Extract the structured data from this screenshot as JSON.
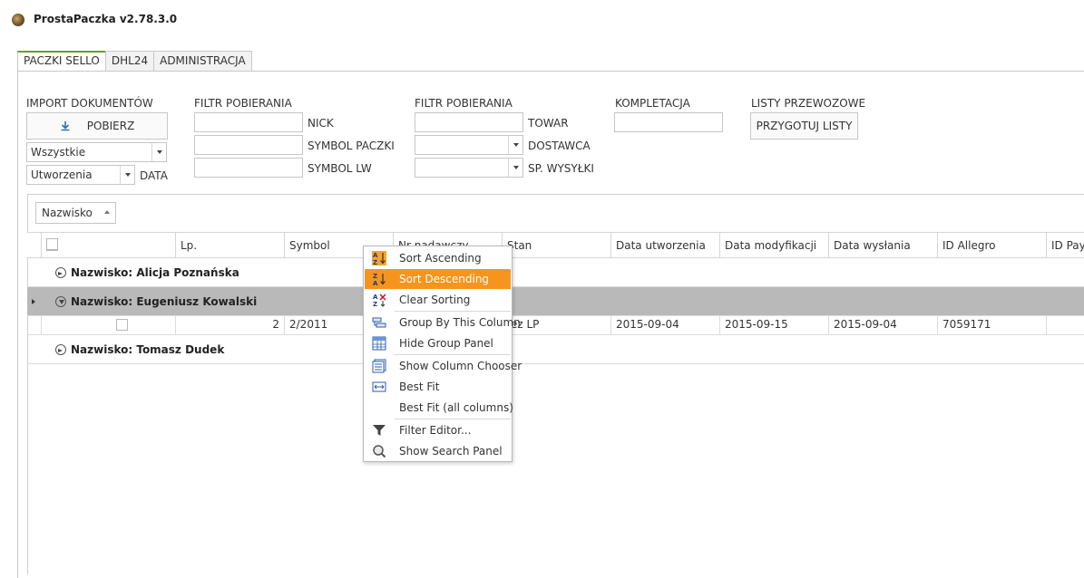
{
  "app": {
    "title": "ProstaPaczka v2.78.3.0"
  },
  "tabs": [
    {
      "label": "PACZKI SELLO",
      "active": true
    },
    {
      "label": "DHL24",
      "active": false
    },
    {
      "label": "ADMINISTRACJA",
      "active": false
    }
  ],
  "import": {
    "heading": "IMPORT DOKUMENTÓW",
    "button_label": "POBIERZ",
    "status_combo": "Wszystkie",
    "date_combo": "Utworzenia",
    "date_label": "DATA"
  },
  "filter1": {
    "heading": "FILTR POBIERANIA",
    "fields": [
      {
        "label": "NICK",
        "value": ""
      },
      {
        "label": "SYMBOL PACZKI",
        "value": ""
      },
      {
        "label": "SYMBOL LW",
        "value": ""
      }
    ]
  },
  "filter2": {
    "heading": "FILTR POBIERANIA",
    "towar_label": "TOWAR",
    "towar_value": "",
    "dostawca_label": "DOSTAWCA",
    "dostawca_value": "",
    "wysylka_label": "SP. WYSYŁKI",
    "wysylka_value": ""
  },
  "kompletacja": {
    "heading": "KOMPLETACJA",
    "value": ""
  },
  "listy": {
    "heading": "LISTY PRZEWOZOWE",
    "button_label": "PRZYGOTUJ LISTY"
  },
  "grid": {
    "group_chip": "Nazwisko",
    "columns": [
      "Lp.",
      "Symbol",
      "Nr nadawczy",
      "Stan",
      "Data utworzenia",
      "Data modyfikacji",
      "Data wysłania",
      "ID Allegro",
      "ID PayU"
    ],
    "groups": [
      {
        "label": "Nazwisko: Alicja Poznańska",
        "expanded": false,
        "selected": false
      },
      {
        "label": "Nazwisko: Eugeniusz Kowalski",
        "expanded": true,
        "selected": true
      },
      {
        "label": "Nazwisko: Tomasz Dudek",
        "expanded": false,
        "selected": false
      }
    ],
    "row": {
      "lp": "2",
      "symbol": "2/2011",
      "stan": "ez LP",
      "data_utworzenia": "2015-09-04",
      "data_modyfikacji": "2015-09-15",
      "data_wyslania": "2015-09-04",
      "id_allegro": "7059171"
    }
  },
  "context_menu": {
    "items": [
      {
        "label": "Sort Ascending",
        "icon": "sort-ascending-icon"
      },
      {
        "label": "Sort Descending",
        "icon": "sort-descending-icon",
        "highlighted": true
      },
      {
        "label": "Clear Sorting",
        "icon": "clear-sorting-icon"
      },
      {
        "label": "Group By This Column",
        "icon": "group-by-icon"
      },
      {
        "label": "Hide Group Panel",
        "icon": "group-panel-icon"
      },
      {
        "label": "Show Column Chooser",
        "icon": "column-chooser-icon"
      },
      {
        "label": "Best Fit",
        "icon": "best-fit-icon"
      },
      {
        "label": "Best Fit (all columns)",
        "icon": ""
      },
      {
        "label": "Filter Editor...",
        "icon": "filter-icon"
      },
      {
        "label": "Show Search Panel",
        "icon": "search-icon"
      }
    ],
    "highlight_color": "#f7941d"
  },
  "colors": {
    "selected_group_row": "#b9b9b9",
    "menu_highlight": "#f7941d"
  }
}
